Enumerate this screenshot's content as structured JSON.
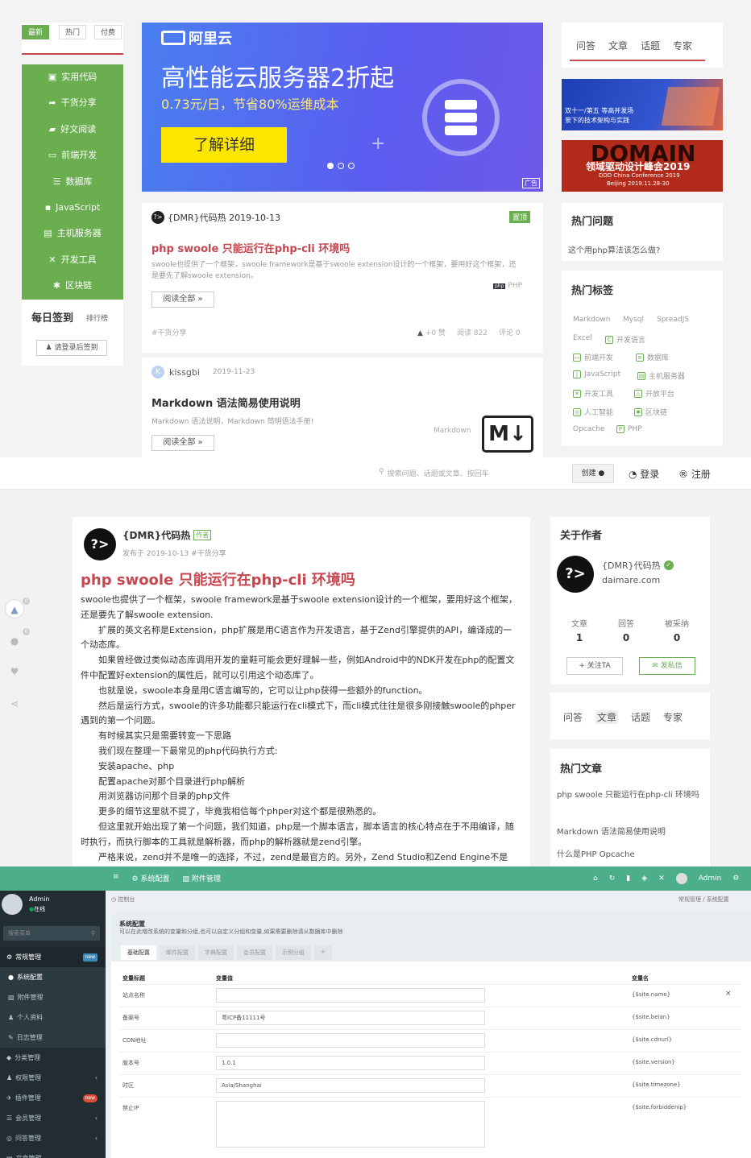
{
  "s1": {
    "tabs": [
      "最新",
      "热门",
      "付费"
    ],
    "nav": [
      "实用代码",
      "干货分享",
      "好文阅读",
      "前端开发",
      "数据库",
      "JavaScript",
      "主机服务器",
      "开发工具",
      "区块链"
    ],
    "sign_title": "每日签到",
    "sign_rank": "排行榜",
    "sign_btn": "请登录后签到",
    "banner": {
      "brand": "阿里云",
      "headline": "高性能云服务器2折起",
      "sub": "0.73元/日，节省80%运维成本",
      "cta": "了解详细",
      "ad": "广告"
    },
    "post1": {
      "author_date": "{DMR}代码热 2019-10-13",
      "pin": "置顶",
      "title": "php swoole 只能运行在php-cli 环境吗",
      "excerpt": "swoole也提供了一个框架，swoole framework是基于swoole extension设计的一个框架，要用好这个框架，还是要先了解swoole extension。",
      "lang": "PHP",
      "read": "阅读全部 »",
      "cat": "#干货分享",
      "likes": "+0 赞",
      "views": "阅读 822",
      "comments": "评论 0"
    },
    "post2": {
      "author": "kissgbi",
      "date": "2019-11-23",
      "title": "Markdown 语法简易使用说明",
      "excerpt": "Markdown 语法说明，Markdown 简明语法手册!",
      "lang": "Markdown",
      "read": "阅读全部 »",
      "logo": "M↓"
    },
    "rtabs": [
      "问答",
      "文章",
      "话题",
      "专家"
    ],
    "ad1": {
      "line1": "双十一/第五 等高并发场",
      "line2": "景下的技术架构与实践"
    },
    "ad2": {
      "big": "DOMAIN",
      "mid": "领域驱动设计峰会2019",
      "small1": "DDD China Conference 2019",
      "small2": "Beijing 2019.11.28-30"
    },
    "hotq": {
      "title": "热门问题",
      "q": "这个用php算法该怎么做?"
    },
    "hottag": {
      "title": "热门标签",
      "tags": [
        "Markdown",
        "Mysql",
        "SpreadJS",
        "Excel",
        "开发语言",
        "前端开发",
        "数据库",
        "JavaScript",
        "主机服务器",
        "开发工具",
        "开放平台",
        "人工智能",
        "区块链",
        "Opcache",
        "PHP"
      ]
    }
  },
  "s2": {
    "search_ph": "搜索问题、话题或文章、按回车",
    "create": "创建",
    "login": "登录",
    "register": "注册",
    "author": "{DMR}代码热",
    "author_badge": "作者",
    "meta": "发布于 2019-10-13 #干货分享",
    "title": "php swoole 只能运行在php-cli 环境吗",
    "paras": [
      "swoole也提供了一个框架，swoole framework是基于swoole extension设计的一个框架，要用好这个框架，还是要先了解swoole extension.",
      "扩展的英文名称是Extension，php扩展是用C语言作为开发语言，基于Zend引擎提供的API，编译成的一个动态库。",
      "如果曾经做过类似动态库调用开发的童鞋可能会更好理解一些，例如Android中的NDK开发在php的配置文件中配置好extension的属性后，就可以引用这个动态库了。",
      "也就是说，swoole本身是用C语言编写的，它可以让php获得一些额外的function。",
      "然后是运行方式，swoole的许多功能都只能运行在cli模式下，而cli模式往往是很多刚接触swoole的phper遇到的第一个问题。",
      "有时候其实只是需要转变一下思路",
      "我们现在整理一下最常见的php代码执行方式:",
      "安装apache、php",
      "配置apache对那个目录进行php解析",
      "用浏览器访问那个目录的php文件",
      "更多的细节这里就不提了，毕竟我相信每个phper对这个都是很熟悉的。",
      "但这里就开始出现了第一个问题，我们知道，php是一个脚本语言，脚本语言的核心特点在于不用编译，随时执行，而执行脚本的工具就是解析器，而php的解析器就是zend引擎。",
      "严格来说，zend并不是唯一的选择，不过，zend是最官方的。另外，Zend Studio和Zend Engine不是"
    ],
    "side_counts": [
      "0",
      "0"
    ],
    "about": {
      "title": "关于作者",
      "name": "{DMR}代码热",
      "site": "daimare.com",
      "stats": [
        [
          "文章",
          "1"
        ],
        [
          "回答",
          "0"
        ],
        [
          "被采纳",
          "0"
        ]
      ],
      "follow": "+ 关注TA",
      "msg": "发私信"
    },
    "rtabs": [
      "问答",
      "文章",
      "话题",
      "专家"
    ],
    "hotart": {
      "title": "热门文章",
      "items": [
        "php swoole 只能运行在php-cli 环境吗",
        "Markdown 语法简易使用说明",
        "什么是PHP Opcache"
      ]
    }
  },
  "s3": {
    "topnav": [
      "≡",
      "系统配置",
      "附件管理"
    ],
    "user": "Admin",
    "user_status": "在线",
    "admin_right": "Admin",
    "search_ph": "搜索菜单",
    "menu": [
      "常规管理",
      "系统配置",
      "附件管理",
      "个人资料",
      "日志管理",
      "分类管理",
      "权限管理",
      "插件管理",
      "会员管理",
      "问答管理",
      "文章管理"
    ],
    "badge_new": "new",
    "crumb": "控制台",
    "crumb_right": "常规管理 / 系统配置",
    "panel_title": "系统配置",
    "panel_desc": "可以在此增改系统的变量和分组,也可以自定义分组和变量,如果需要删除请从数据库中删除",
    "tabs": [
      "基础配置",
      "邮件配置",
      "字典配置",
      "会员配置",
      "示例分组",
      "+"
    ],
    "head": [
      "变量标题",
      "变量值",
      "变量名"
    ],
    "rows": [
      [
        "站点名称",
        "",
        "{$site.name}"
      ],
      [
        "备案号",
        "粤ICP备11111号",
        "{$site.beian}"
      ],
      [
        "CDN地址",
        "",
        "{$site.cdnurl}"
      ],
      [
        "版本号",
        "1.0.1",
        "{$site.version}"
      ],
      [
        "时区",
        "Asia/Shanghai",
        "{$site.timezone}"
      ],
      [
        "禁止IP",
        "",
        "{$site.forbiddenip}"
      ]
    ]
  }
}
